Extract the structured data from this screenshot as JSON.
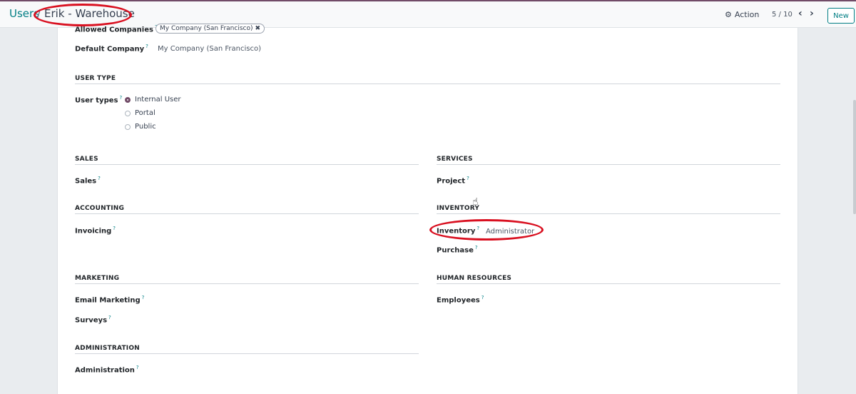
{
  "breadcrumb": {
    "parent": "Users",
    "separator": "/",
    "current": "Erik - Warehouse"
  },
  "toolbar": {
    "action_label": "Action",
    "action_icon": "gear-icon",
    "pager": "5 / 10",
    "prev_icon": "chevron-left-icon",
    "next_icon": "chevron-right-icon",
    "new_label": "New"
  },
  "form": {
    "allowed_companies_label": "Allowed Companies",
    "allowed_companies_tag": "My Company (San Francisco)",
    "default_company_label": "Default Company",
    "default_company_value": "My Company (San Francisco)",
    "user_type_section": "USER TYPE",
    "user_types_label": "User types",
    "user_types_options": [
      "Internal User",
      "Portal",
      "Public"
    ],
    "user_types_selected": "Internal User",
    "sections": {
      "sales": "SALES",
      "services": "SERVICES",
      "accounting": "ACCOUNTING",
      "inventory": "INVENTORY",
      "marketing": "MARKETING",
      "human_resources": "HUMAN RESOURCES",
      "administration": "ADMINISTRATION"
    },
    "fields": {
      "sales": "Sales",
      "project": "Project",
      "invoicing": "Invoicing",
      "inventory": "Inventory",
      "inventory_value": "Administrator",
      "purchase": "Purchase",
      "email_marketing": "Email Marketing",
      "employees": "Employees",
      "surveys": "Surveys",
      "administration": "Administration"
    },
    "help_mark": "?"
  },
  "colors": {
    "brand": "#714b67",
    "link": "#017e84",
    "annotation": "#d91020"
  }
}
